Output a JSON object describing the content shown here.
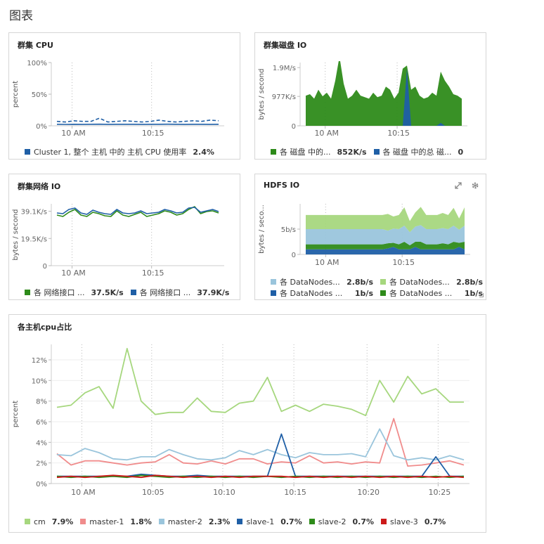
{
  "page": {
    "title": "图表"
  },
  "cards": [
    {
      "id": "cluster-cpu",
      "title": "群集 CPU",
      "ylabel": "percent",
      "yticks": [
        "100%",
        "50%",
        "0%"
      ],
      "xticks": [
        "10 AM",
        "10:15"
      ],
      "legend": [
        {
          "label": "Cluster 1, 整个 主机 中的 主机 CPU 使用率",
          "value": "2.4%",
          "color": "#1f5fa6"
        }
      ]
    },
    {
      "id": "cluster-disk-io",
      "title": "群集磁盘 IO",
      "ylabel": "bytes / second",
      "yticks": [
        "1.9M/s",
        "977K/s",
        "0"
      ],
      "xticks": [
        "10 AM",
        "10:15"
      ],
      "legend": [
        {
          "label": "各 磁盘 中的...",
          "value": "852K/s",
          "color": "#2e8b1a"
        },
        {
          "label": "各 磁盘 中的总 磁...",
          "value": "0",
          "color": "#1f5fa6"
        }
      ]
    },
    {
      "id": "cluster-network-io",
      "title": "群集网络 IO",
      "ylabel": "bytes / second",
      "yticks": [
        "39.1K/s",
        "19.5K/s",
        "0"
      ],
      "xticks": [
        "10 AM",
        "10:15"
      ],
      "legend": [
        {
          "label": "各 网络接口 ...",
          "value": "37.5K/s",
          "color": "#2e8b1a"
        },
        {
          "label": "各 网络接口 ...",
          "value": "37.9K/s",
          "color": "#1f5fa6"
        }
      ]
    },
    {
      "id": "hdfs-io",
      "title": "HDFS IO",
      "ylabel": "bytes / seco...",
      "yticks": [
        "5b/s",
        "0"
      ],
      "xticks": [
        "10 AM",
        "10:15"
      ],
      "actions": [
        "expand-icon",
        "gear-icon"
      ],
      "legend": [
        {
          "label": "各 DataNodes...",
          "value": "2.8b/s",
          "color": "#9ac5dc"
        },
        {
          "label": "各 DataNodes...",
          "value": "2.8b/s",
          "color": "#a6d77e"
        },
        {
          "label": "各 DataNodes ...",
          "value": "1b/s",
          "color": "#1f5fa6"
        },
        {
          "label": "各 DataNodes ...",
          "value": "1b/s",
          "color": "#2e8b1a"
        }
      ]
    },
    {
      "id": "host-cpu-share",
      "title": "各主机cpu占比",
      "ylabel": "percent",
      "yticks": [
        "12%",
        "10%",
        "8%",
        "6%",
        "4%",
        "2%",
        "0%"
      ],
      "xticks": [
        "10 AM",
        "10:05",
        "10:10",
        "10:15",
        "10:20",
        "10:25"
      ],
      "legend": [
        {
          "label": "cm",
          "value": "7.9%",
          "color": "#a6d77e"
        },
        {
          "label": "master-1",
          "value": "1.8%",
          "color": "#f08c8c"
        },
        {
          "label": "master-2",
          "value": "2.3%",
          "color": "#9ac5dc"
        },
        {
          "label": "slave-1",
          "value": "0.7%",
          "color": "#1f5fa6"
        },
        {
          "label": "slave-2",
          "value": "0.7%",
          "color": "#2e8b1a"
        },
        {
          "label": "slave-3",
          "value": "0.7%",
          "color": "#cc1a1a"
        }
      ]
    }
  ],
  "chart_data": [
    {
      "type": "line",
      "ylim": [
        0,
        100
      ],
      "series": [
        {
          "values": [
            2.4,
            2.2,
            2.5,
            2.3,
            2.4,
            2.6,
            2.3,
            2.4,
            2.5,
            2.4,
            2.3,
            2.5,
            2.4,
            2.6,
            2.4,
            2.3,
            2.5,
            2.4,
            2.3,
            2.4
          ],
          "color": "#1f5fa6"
        },
        {
          "values": [
            7,
            6,
            8,
            7,
            7,
            12,
            6,
            7,
            8,
            7,
            6,
            7,
            9,
            7,
            6,
            7,
            8,
            7,
            9,
            8
          ],
          "color": "#1f5fa6",
          "dashed": true
        }
      ]
    },
    {
      "type": "area",
      "ylim": [
        0,
        2100
      ],
      "series": [
        {
          "values": [
            1000,
            1050,
            900,
            1200,
            980,
            1100,
            900,
            1500,
            2300,
            1400,
            900,
            1000,
            1200,
            1000,
            950,
            900,
            1100,
            950,
            1000,
            1300,
            1200,
            900,
            1100,
            1900,
            2000,
            1200,
            1300,
            1000,
            900,
            950,
            1100,
            1000,
            1800,
            1500,
            1300,
            1050,
            1000,
            900
          ],
          "color": "#2e8b1a"
        },
        {
          "values": [
            0,
            0,
            0,
            0,
            0,
            0,
            0,
            0,
            0,
            0,
            0,
            0,
            0,
            0,
            0,
            0,
            0,
            0,
            0,
            0,
            0,
            0,
            0,
            0,
            1900,
            0,
            0,
            0,
            0,
            0,
            0,
            0,
            100,
            0,
            0,
            0,
            0,
            0
          ],
          "color": "#1f5fa6"
        }
      ]
    },
    {
      "type": "line",
      "ylim": [
        0,
        44000
      ],
      "series": [
        {
          "values": [
            36000,
            35000,
            38000,
            40000,
            36000,
            35000,
            38000,
            37000,
            35500,
            35000,
            39000,
            36000,
            35000,
            36500,
            38000,
            35000,
            36000,
            37000,
            39000,
            38000,
            36000,
            37000,
            40000,
            42000,
            37000,
            38500,
            39000,
            37500
          ],
          "color": "#2e8b1a"
        },
        {
          "values": [
            37500,
            37000,
            40000,
            41000,
            37500,
            36500,
            39500,
            38000,
            37000,
            36500,
            40000,
            37500,
            37000,
            37500,
            39000,
            37000,
            37500,
            38000,
            40000,
            39000,
            37500,
            38000,
            41000,
            41500,
            38000,
            39000,
            40000,
            38500
          ],
          "color": "#1f5fa6"
        }
      ]
    },
    {
      "type": "area",
      "ylim": [
        0,
        10
      ],
      "series": [
        {
          "values": [
            1,
            1,
            1,
            1,
            1,
            1,
            1,
            1,
            1,
            1,
            1,
            1,
            1,
            1,
            1,
            1.2,
            1.5,
            1,
            1,
            1,
            1.5,
            1,
            1,
            1,
            1,
            1,
            1,
            1,
            1.5,
            1
          ],
          "color": "#1f5fa6"
        },
        {
          "values": [
            1,
            1,
            1,
            1,
            1,
            1,
            1,
            1,
            1,
            1,
            1,
            1,
            1,
            1,
            1,
            1,
            0.8,
            1,
            1.5,
            0.8,
            1,
            1.5,
            1,
            1,
            1,
            1.2,
            1,
            1.5,
            0.8,
            1.5
          ],
          "color": "#2e8b1a"
        },
        {
          "values": [
            3,
            3,
            3,
            3,
            3,
            3,
            3,
            3,
            3,
            3,
            3,
            3,
            3,
            3,
            3,
            2.5,
            2.8,
            3,
            3.2,
            2.6,
            3,
            3.3,
            3,
            3,
            3,
            3,
            3,
            3.2,
            2.6,
            3.2
          ],
          "color": "#9ac5dc"
        },
        {
          "values": [
            2.8,
            2.8,
            2.8,
            2.8,
            2.8,
            2.8,
            2.8,
            2.8,
            2.8,
            2.8,
            2.8,
            2.8,
            2.8,
            2.8,
            2.8,
            3.3,
            2.4,
            2.8,
            3.6,
            2.2,
            2.8,
            3.6,
            2.8,
            2.8,
            2.8,
            3,
            2.8,
            3.5,
            2.2,
            3.6
          ],
          "color": "#a6d77e"
        }
      ]
    },
    {
      "type": "line",
      "ylim": [
        0,
        13.5
      ],
      "series": [
        {
          "name": "cm",
          "color": "#a6d77e",
          "values": [
            7.4,
            7.6,
            8.8,
            9.4,
            7.3,
            13.1,
            8.0,
            6.7,
            6.9,
            6.9,
            8.3,
            7.0,
            6.9,
            7.8,
            8.0,
            10.3,
            7.0,
            7.6,
            7.0,
            7.7,
            7.5,
            7.2,
            6.6,
            10.0,
            7.9,
            10.4,
            8.7,
            9.2,
            7.9,
            7.9
          ]
        },
        {
          "name": "master-1",
          "color": "#f08c8c",
          "values": [
            2.9,
            1.8,
            2.2,
            2.2,
            2.0,
            1.8,
            2.0,
            2.1,
            2.8,
            2.0,
            1.9,
            2.2,
            1.9,
            2.4,
            2.4,
            1.9,
            2.1,
            2.0,
            2.7,
            2.0,
            2.1,
            1.9,
            2.1,
            2.0,
            6.3,
            1.7,
            1.8,
            2.0,
            2.2,
            1.8
          ]
        },
        {
          "name": "master-2",
          "color": "#9ac5dc",
          "values": [
            2.8,
            2.7,
            3.4,
            3.0,
            2.4,
            2.3,
            2.6,
            2.6,
            3.3,
            2.8,
            2.4,
            2.3,
            2.5,
            3.2,
            2.8,
            3.3,
            2.8,
            2.5,
            3.0,
            2.8,
            2.8,
            2.9,
            2.6,
            5.3,
            2.7,
            2.3,
            2.5,
            2.3,
            2.7,
            2.3
          ]
        },
        {
          "name": "slave-1",
          "color": "#1f5fa6",
          "values": [
            0.7,
            0.7,
            0.7,
            0.7,
            0.7,
            0.7,
            0.9,
            0.8,
            0.7,
            0.7,
            0.8,
            0.7,
            0.7,
            0.7,
            0.7,
            0.7,
            4.8,
            0.7,
            0.7,
            0.7,
            0.7,
            0.7,
            0.7,
            0.7,
            0.7,
            0.7,
            0.7,
            2.6,
            0.7,
            0.7
          ]
        },
        {
          "name": "slave-2",
          "color": "#2e8b1a",
          "values": [
            0.7,
            0.6,
            0.7,
            0.6,
            0.7,
            0.6,
            0.8,
            0.7,
            0.6,
            0.7,
            0.6,
            0.7,
            0.6,
            0.7,
            0.6,
            0.7,
            0.6,
            0.7,
            0.6,
            0.7,
            0.6,
            0.7,
            0.6,
            0.7,
            0.6,
            0.7,
            0.6,
            0.7,
            0.6,
            0.7
          ]
        },
        {
          "name": "slave-3",
          "color": "#cc1a1a",
          "values": [
            0.6,
            0.7,
            0.6,
            0.7,
            0.8,
            0.7,
            0.6,
            0.8,
            0.7,
            0.6,
            0.7,
            0.6,
            0.7,
            0.6,
            0.7,
            0.7,
            0.7,
            0.6,
            0.7,
            0.6,
            0.7,
            0.6,
            0.7,
            0.6,
            0.7,
            0.6,
            0.7,
            0.6,
            0.7,
            0.6
          ]
        }
      ]
    }
  ]
}
